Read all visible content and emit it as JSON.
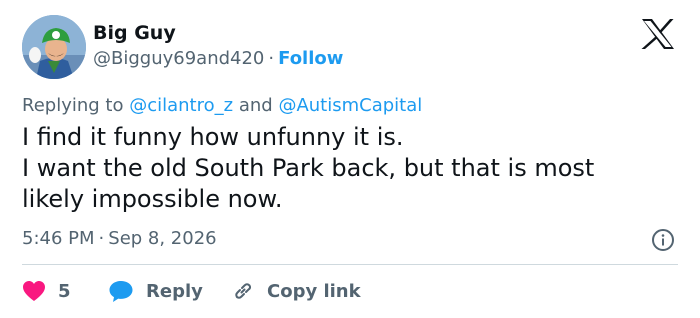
{
  "author": {
    "display_name": "Big Guy",
    "handle": "@Bigguy69and420",
    "follow_label": "Follow"
  },
  "reply_context": {
    "prefix": "Replying to",
    "mention_1": "@cilantro_z",
    "conjunction": "and",
    "mention_2": "@AutismCapital"
  },
  "tweet": {
    "lines": [
      "I find it funny how unfunny it is.",
      "I want the old South Park back, but that is most",
      "likely impossible now."
    ]
  },
  "meta": {
    "time": "5:46 PM",
    "date": "Sep 8, 2026"
  },
  "actions": {
    "like_count": "5",
    "reply_label": "Reply",
    "copy_label": "Copy link"
  },
  "icons": {
    "logo": "x-logo-icon",
    "info": "info-icon",
    "like": "heart-icon",
    "reply": "speech-bubble-icon",
    "copy": "link-icon"
  },
  "colors": {
    "accent": "#1d9bf0",
    "like": "#f91880",
    "secondary_text": "#536471",
    "primary_text": "#0f1419",
    "divider": "#cfd9de"
  },
  "separator": "·"
}
